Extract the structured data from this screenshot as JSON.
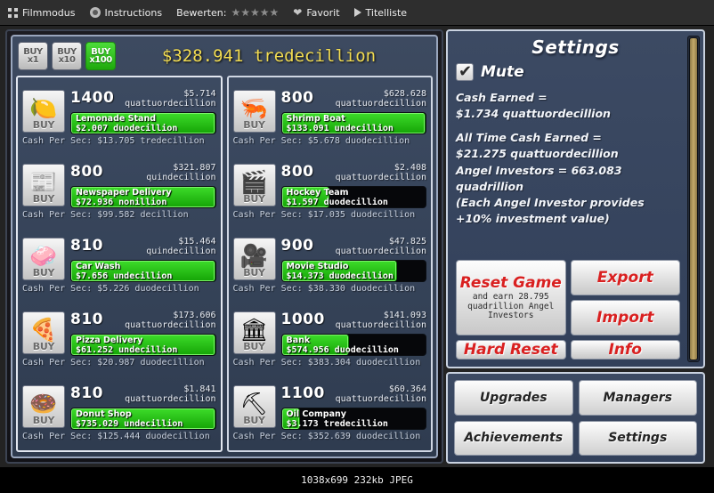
{
  "topbar": {
    "film_mode": "Filmmodus",
    "instructions": "Instructions",
    "rate_label": "Bewerten:",
    "stars": "★★★★★",
    "favorite": "Favorit",
    "titlelist": "Titelliste"
  },
  "game": {
    "buy_buttons": [
      {
        "line1": "BUY",
        "line2": "x1",
        "active": false
      },
      {
        "line1": "BUY",
        "line2": "x10",
        "active": false
      },
      {
        "line1": "BUY",
        "line2": "x100",
        "active": true
      }
    ],
    "money": "$328.941 tredecillion",
    "businesses": [
      {
        "name": "Lemonade Stand",
        "icon": "lemon-icon",
        "glyph": "🍋",
        "count": "1400",
        "cost": "$5.714",
        "cost_unit": "quattuordecillion",
        "revenue": "$2.007 duodecillion",
        "bar_fill": 100,
        "cps": "Cash Per Sec: $13.705 tredecillion",
        "buy_label": "BUY",
        "column": 1
      },
      {
        "name": "Newspaper Delivery",
        "icon": "newspaper-icon",
        "glyph": "📰",
        "count": "800",
        "cost": "$321.807",
        "cost_unit": "quindecillion",
        "revenue": "$72.936 nonillion",
        "bar_fill": 100,
        "cps": "Cash Per Sec: $99.582 decillion",
        "buy_label": "BUY",
        "column": 1
      },
      {
        "name": "Car Wash",
        "icon": "carwash-icon",
        "glyph": "🧼",
        "count": "810",
        "cost": "$15.464",
        "cost_unit": "quindecillion",
        "revenue": "$7.656 undecillion",
        "bar_fill": 100,
        "cps": "Cash Per Sec: $5.226 duodecillion",
        "buy_label": "BUY",
        "column": 1
      },
      {
        "name": "Pizza Delivery",
        "icon": "pizza-icon",
        "glyph": "🍕",
        "count": "810",
        "cost": "$173.606",
        "cost_unit": "quattuordecillion",
        "revenue": "$61.252 undecillion",
        "bar_fill": 100,
        "cps": "Cash Per Sec: $20.987 duodecillion",
        "buy_label": "BUY",
        "column": 1
      },
      {
        "name": "Donut Shop",
        "icon": "donut-icon",
        "glyph": "🍩",
        "count": "810",
        "cost": "$1.841",
        "cost_unit": "quattuordecillion",
        "revenue": "$735.029 undecillion",
        "bar_fill": 100,
        "cps": "Cash Per Sec: $125.444 duodecillion",
        "buy_label": "BUY",
        "column": 1
      },
      {
        "name": "Shrimp Boat",
        "icon": "shrimp-icon",
        "glyph": "🦐",
        "count": "800",
        "cost": "$628.628",
        "cost_unit": "quattuordecillion",
        "revenue": "$133.091 undecillion",
        "bar_fill": 100,
        "cps": "Cash Per Sec: $5.678 duodecillion",
        "buy_label": "BUY",
        "column": 2
      },
      {
        "name": "Hockey Team",
        "icon": "hockey-icon",
        "glyph": "🎬",
        "count": "800",
        "cost": "$2.408",
        "cost_unit": "quattuordecillion",
        "revenue": "$1.597 duodecillion",
        "bar_fill": 33,
        "cps": "Cash Per Sec: $17.035 duodecillion",
        "buy_label": "BUY",
        "column": 2
      },
      {
        "name": "Movie Studio",
        "icon": "movie-camera-icon",
        "glyph": "🎥",
        "count": "900",
        "cost": "$47.825",
        "cost_unit": "quattuordecillion",
        "revenue": "$14.373 duodecillion",
        "bar_fill": 80,
        "cps": "Cash Per Sec: $38.330 duodecillion",
        "buy_label": "BUY",
        "column": 2
      },
      {
        "name": "Bank",
        "icon": "bank-icon",
        "glyph": "🏛",
        "count": "1000",
        "cost": "$141.093",
        "cost_unit": "quattuordecillion",
        "revenue": "$574.956 duodecillion",
        "bar_fill": 47,
        "cps": "Cash Per Sec: $383.304 duodecillion",
        "buy_label": "BUY",
        "column": 2
      },
      {
        "name": "Oil Company",
        "icon": "oil-pump-icon",
        "glyph": "⛏",
        "count": "1100",
        "cost": "$60.364",
        "cost_unit": "quattuordecillion",
        "revenue": "$3.173 tredecillion",
        "bar_fill": 13,
        "cps": "Cash Per Sec: $352.639 duodecillion",
        "buy_label": "BUY",
        "column": 2
      }
    ]
  },
  "settings": {
    "title": "Settings",
    "mute_label": "Mute",
    "mute_checked": true,
    "cash_earned_label": "Cash Earned =",
    "cash_earned_value": "$1.734 quattuordecillion",
    "all_time_label": "All Time Cash Earned =",
    "all_time_value": "$21.275 quattuordecillion",
    "angel_line1": "Angel Investors = 663.083",
    "angel_line2": "quadrillion",
    "angel_note1": "(Each Angel Investor provides",
    "angel_note2": "+10% investment value)",
    "reset_game": "Reset Game",
    "reset_sub": "and earn 28.795 quadrillion Angel Investors",
    "export": "Export",
    "import": "Import",
    "hard_reset": "Hard Reset",
    "info": "Info"
  },
  "nav": {
    "upgrades": "Upgrades",
    "managers": "Managers",
    "achievements": "Achievements",
    "settings": "Settings"
  },
  "statusbar": {
    "text": "1038x699 232kb JPEG"
  },
  "colors": {
    "accent_money": "#f2dc52",
    "buy_active": "#1ea80c",
    "panel_blue": "#3c4a63",
    "reset_red": "#d92020",
    "scrollbar": "#c3aa6a"
  }
}
